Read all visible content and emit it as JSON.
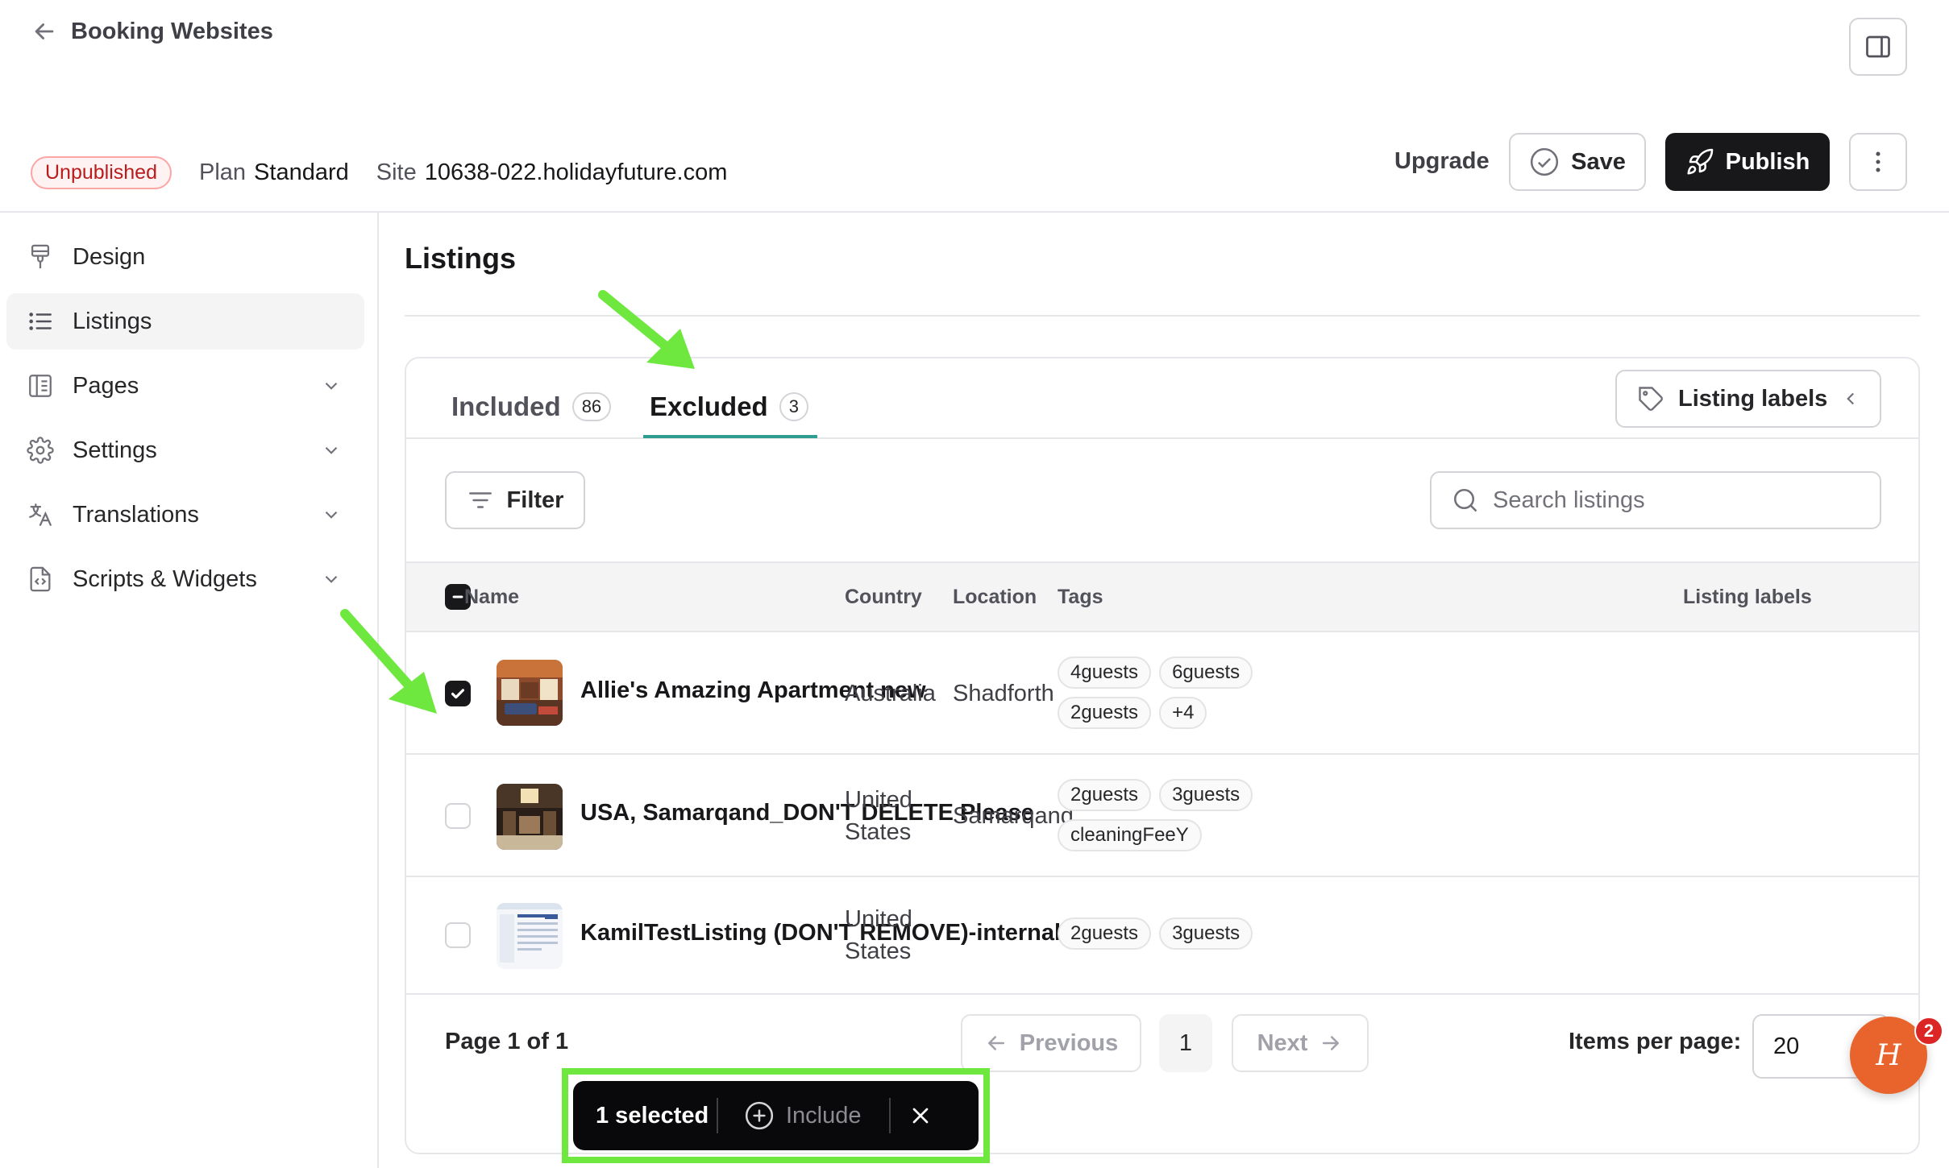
{
  "header": {
    "back_label": "Booking Websites",
    "status_badge": "Unpublished",
    "plan_label": "Plan",
    "plan_value": "Standard",
    "site_label": "Site",
    "site_value": "10638-022.holidayfuture.com",
    "upgrade_label": "Upgrade",
    "save_label": "Save",
    "publish_label": "Publish"
  },
  "sidebar": {
    "items": [
      {
        "label": "Design",
        "icon": "paintbrush-icon"
      },
      {
        "label": "Listings",
        "icon": "list-icon",
        "active": true
      },
      {
        "label": "Pages",
        "icon": "page-icon"
      },
      {
        "label": "Settings",
        "icon": "gear-icon"
      },
      {
        "label": "Translations",
        "icon": "translate-icon"
      },
      {
        "label": "Scripts & Widgets",
        "icon": "code-file-icon"
      }
    ]
  },
  "main": {
    "title": "Listings",
    "tabs": [
      {
        "label": "Included",
        "count": "86"
      },
      {
        "label": "Excluded",
        "count": "3",
        "active": true
      }
    ],
    "listing_labels_button": "Listing labels",
    "filter_label": "Filter",
    "search_placeholder": "Search listings",
    "columns": [
      "Name",
      "Country",
      "Location",
      "Tags",
      "Listing labels"
    ],
    "rows": [
      {
        "name": "Allie's Amazing Apartment new",
        "country_line1": "Australia",
        "country_line2": "",
        "location": "Shadforth",
        "tags": [
          "4guests",
          "6guests",
          "2guests",
          "+4"
        ],
        "checked": true
      },
      {
        "name": "USA, Samarqand_DON'T DELETE Please",
        "country_line1": "United",
        "country_line2": "States",
        "location": "Samarqand",
        "tags": [
          "2guests",
          "3guests",
          "cleaningFeeY"
        ],
        "checked": false
      },
      {
        "name": "KamilTestListing (DON'T REMOVE)-internal",
        "country_line1": "United",
        "country_line2": "States",
        "location": "",
        "tags": [
          "2guests",
          "3guests"
        ],
        "checked": false
      }
    ],
    "pagination": {
      "page_info": "Page 1 of 1",
      "previous_label": "Previous",
      "current_page": "1",
      "next_label": "Next",
      "items_per_page_label": "Items per page:",
      "items_per_page_value": "20"
    }
  },
  "bulk_bar": {
    "selected_label": "1 selected",
    "include_label": "Include"
  },
  "help": {
    "badge_count": "2",
    "glyph": "H"
  },
  "colors": {
    "accent_tab": "#2d9e8f",
    "publish_bg": "#18181b",
    "annotation": "#6ee83f",
    "help_bg": "#e8642c"
  }
}
